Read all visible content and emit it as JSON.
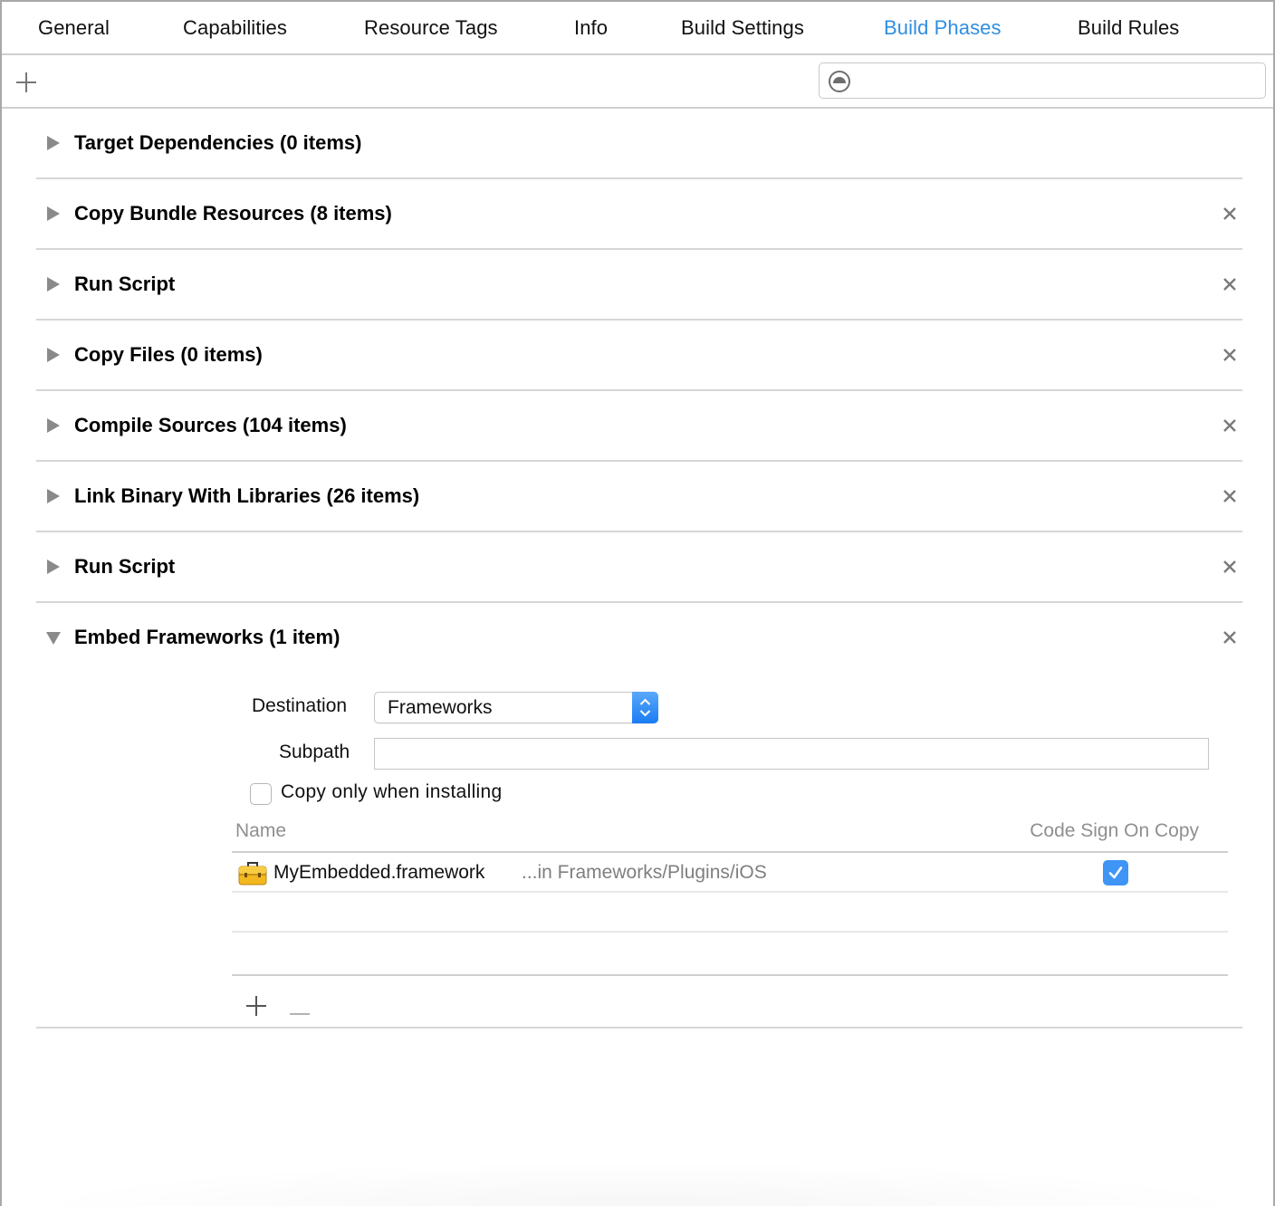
{
  "tabs": [
    {
      "label": "General",
      "active": false
    },
    {
      "label": "Capabilities",
      "active": false
    },
    {
      "label": "Resource Tags",
      "active": false
    },
    {
      "label": "Info",
      "active": false
    },
    {
      "label": "Build Settings",
      "active": false
    },
    {
      "label": "Build Phases",
      "active": true
    },
    {
      "label": "Build Rules",
      "active": false
    }
  ],
  "toolbar": {
    "add_icon": "plus-icon",
    "filter_icon": "filter-icon",
    "filter_value": "",
    "filter_placeholder": ""
  },
  "phases": [
    {
      "title": "Target Dependencies (0 items)",
      "expanded": false,
      "removable": false
    },
    {
      "title": "Copy Bundle Resources (8 items)",
      "expanded": false,
      "removable": true
    },
    {
      "title": "Run Script",
      "expanded": false,
      "removable": true
    },
    {
      "title": "Copy Files (0 items)",
      "expanded": false,
      "removable": true
    },
    {
      "title": "Compile Sources (104 items)",
      "expanded": false,
      "removable": true
    },
    {
      "title": "Link Binary With Libraries (26 items)",
      "expanded": false,
      "removable": true
    },
    {
      "title": "Run Script",
      "expanded": false,
      "removable": true
    },
    {
      "title": "Embed Frameworks (1 item)",
      "expanded": true,
      "removable": true
    }
  ],
  "embed": {
    "destination_label": "Destination",
    "destination_value": "Frameworks",
    "subpath_label": "Subpath",
    "subpath_value": "",
    "copy_only_label": "Copy only when installing",
    "copy_only_checked": false,
    "columns": {
      "name": "Name",
      "code_sign": "Code Sign On Copy"
    },
    "items": [
      {
        "icon": "toolbox-icon",
        "name": "MyEmbedded.framework",
        "location": "...in Frameworks/Plugins/iOS",
        "code_sign_on_copy": true
      }
    ]
  },
  "colors": {
    "accent": "#2f8ee0",
    "checkbox_checked": "#3e95f6",
    "divider": "#d6d6d6"
  }
}
